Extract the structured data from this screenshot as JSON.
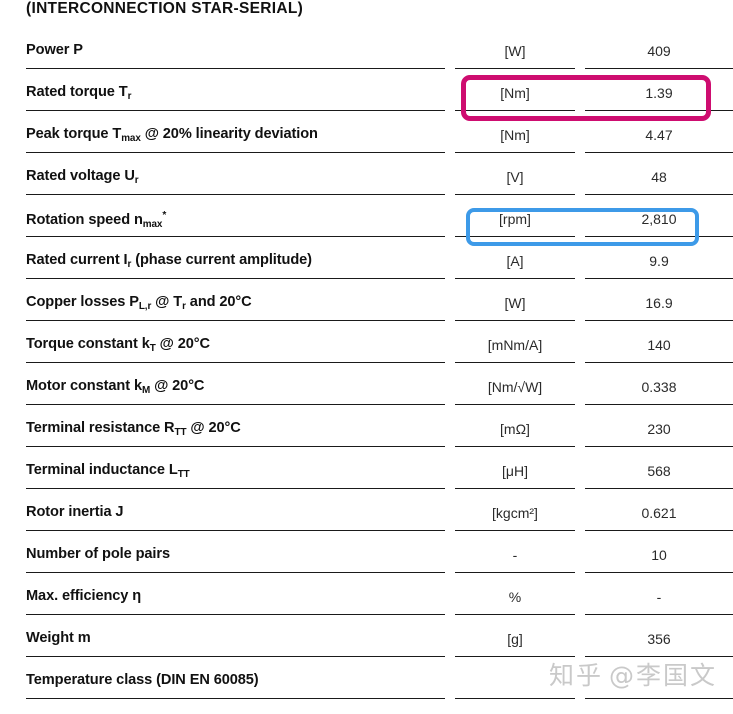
{
  "heading": "(INTERCONNECTION STAR-SERIAL)",
  "columns": {
    "parameter": "",
    "unit": "",
    "value": ""
  },
  "rows": [
    {
      "label_html": "Power P",
      "label_text": "Power P",
      "unit": "[W]",
      "value": "409",
      "highlight": "none"
    },
    {
      "label_html": "Rated torque T<sub>r</sub>",
      "label_text": "Rated torque Tr",
      "unit": "[Nm]",
      "value": "1.39",
      "highlight": "magenta"
    },
    {
      "label_html": "Peak torque T<sub>max</sub> @ 20% linearity deviation",
      "label_text": "Peak torque Tmax @ 20% linearity deviation",
      "unit": "[Nm]",
      "value": "4.47",
      "highlight": "none"
    },
    {
      "label_html": "Rated voltage U<sub>r</sub>",
      "label_text": "Rated voltage Ur",
      "unit": "[V]",
      "value": "48",
      "highlight": "none"
    },
    {
      "label_html": "Rotation speed n<sub>max</sub><span class=\"star\">*</span>",
      "label_text": "Rotation speed nmax*",
      "unit": "[rpm]",
      "value": "2,810",
      "highlight": "blue"
    },
    {
      "label_html": "Rated current I<sub>r</sub> (phase current amplitude)",
      "label_text": "Rated current Ir (phase current amplitude)",
      "unit": "[A]",
      "value": "9.9",
      "highlight": "none"
    },
    {
      "label_html": "Copper losses P<sub>L,r</sub> @ T<sub>r</sub> and 20°C",
      "label_text": "Copper losses PL,r @ Tr and 20°C",
      "unit": "[W]",
      "value": "16.9",
      "highlight": "none"
    },
    {
      "label_html": "Torque constant k<sub>T</sub> @ 20°C",
      "label_text": "Torque constant kT @ 20°C",
      "unit": "[mNm/A]",
      "value": "140",
      "highlight": "none"
    },
    {
      "label_html": "Motor constant k<sub>M</sub> @ 20°C",
      "label_text": "Motor constant kM @ 20°C",
      "unit": "[Nm/√W]",
      "value": "0.338",
      "highlight": "none"
    },
    {
      "label_html": "Terminal resistance R<sub>TT</sub> @ 20°C",
      "label_text": "Terminal resistance RTT @ 20°C",
      "unit": "[mΩ]",
      "value": "230",
      "highlight": "none"
    },
    {
      "label_html": "Terminal inductance L<sub>TT</sub>",
      "label_text": "Terminal inductance LTT",
      "unit": "[μH]",
      "value": "568",
      "highlight": "none"
    },
    {
      "label_html": "Rotor inertia J",
      "label_text": "Rotor inertia J",
      "unit": "[kgcm²]",
      "value": "0.621",
      "highlight": "none"
    },
    {
      "label_html": "Number of pole pairs",
      "label_text": "Number of pole pairs",
      "unit": "-",
      "value": "10",
      "highlight": "none"
    },
    {
      "label_html": "Max. efficiency η",
      "label_text": "Max. efficiency η",
      "unit": "%",
      "value": "-",
      "highlight": "none"
    },
    {
      "label_html": "Weight m",
      "label_text": "Weight m",
      "unit": "[g]",
      "value": "356",
      "highlight": "none"
    },
    {
      "label_html": "Temperature class (DIN EN 60085)",
      "label_text": "Temperature class (DIN EN 60085)",
      "unit": "",
      "value": "",
      "highlight": "none"
    }
  ],
  "highlight_colors": {
    "magenta": "#ce0d70",
    "blue": "#3d9ae8"
  },
  "watermark": {
    "logo": "知乎",
    "handle": "@李国文"
  }
}
